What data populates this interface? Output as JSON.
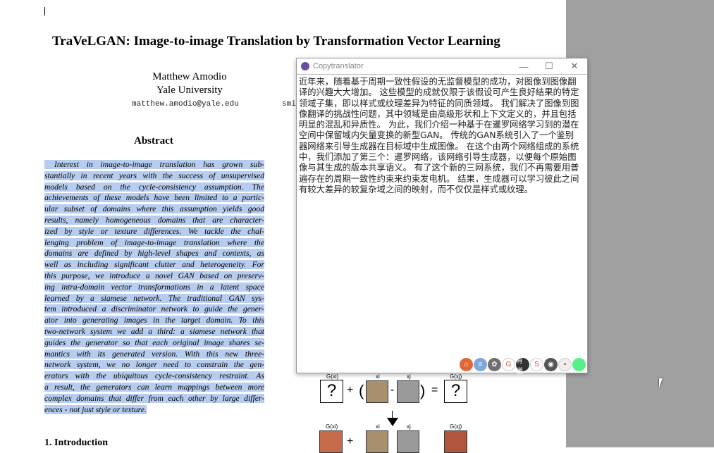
{
  "paper": {
    "title": "TraVeLGAN: Image-to-image Translation by Transformation Vector Learning",
    "author_name": "Matthew Amodio",
    "author_affil": "Yale University",
    "author_email": "matthew.amodio@yale.edu",
    "author2_email_partial": "smi",
    "abstract_heading": "Abstract",
    "abstract_lines": [
      "Interest in image-to-image translation has grown sub-",
      "stantially in recent years with the success of unsupervised",
      "models based on the cycle-consistency assumption.  The",
      "achievements of these models have been limited to a partic-",
      "ular subset of domains where this assumption yields good",
      "results, namely homogeneous domains that are character-",
      "ized by style or texture differences.  We tackle the chal-",
      "lenging problem of image-to-image translation where the",
      "domains are defined by high-level shapes and contexts, as",
      "well as including significant clutter and heterogeneity.  For",
      "this purpose, we introduce a novel GAN based on preserv-",
      "ing intra-domain vector transformations in a latent space",
      "learned by a siamese network.  The traditional GAN sys-",
      "tem introduced a discriminator network to guide the gener-",
      "ator into generating images in the target domain.  To this",
      "two-network system we add a third: a siamese network that",
      "guides the generator so that each original image shares se-",
      "mantics with its generated version.  With this new three-",
      "network system, we no longer need to constrain the gen-",
      "erators with the ubiquitous cycle-consistency restraint.  As",
      "a result, the generators can learn mappings between more",
      "complex domains that differ from each other by large differ-",
      "ences - not just style or texture."
    ],
    "intro_heading": "1. Introduction",
    "figure": {
      "gxi": "G(xi)",
      "gxj": "G(xj)",
      "xi": "xi",
      "xj": "xj",
      "q": "?",
      "plus": "+",
      "minus": "-",
      "eq": "=",
      "lp": "(",
      "rp": ")"
    }
  },
  "window": {
    "title": "Copytranslator",
    "minimize": "—",
    "maximize": "☐",
    "close": "✕",
    "translation_lines": [
      "近年来，随着基于周期一致性假设的无监督模型的成功，对图像到图像翻",
      "译的兴趣大大增加。 这些模型的成就仅限于该假设可产生良好结果的特定",
      "领域子集，即以样式或纹理差异为特征的同质领域。 我们解决了图像到图",
      "像翻译的挑战性问题，其中领域是由高级形状和上下文定义的，并且包括",
      "明显的混乱和异质性。 为此，我们介绍一种基于在暹罗网络学习到的潜在",
      "空间中保留域内矢量变换的新型GAN。 传统的GAN系统引入了一个鉴别",
      "器网络来引导生成器在目标域中生成图像。 在这个由两个网络组成的系统",
      "中，我们添加了第三个：暹罗网络，该网络引导生成器，以便每个原始图",
      "像与其生成的版本共享语义。 有了这个新的三网系统，我们不再需要用普",
      "遍存在的周期一致性约束来约束发电机。 结果，生成器可以学习彼此之间",
      "有较大差异的较复杂域之间的映射，而不仅仅是样式或纹理。"
    ],
    "engines": [
      {
        "name": "home",
        "color": "#e0663a",
        "glyph": "⌂"
      },
      {
        "name": "docs",
        "color": "#7fa7d9",
        "glyph": "≡"
      },
      {
        "name": "baidu",
        "color": "#6f6f6f",
        "glyph": "✿"
      },
      {
        "name": "google",
        "color": "#ffffff",
        "glyph": "G"
      },
      {
        "name": "youdao",
        "color": "#333333",
        "glyph": "有道"
      },
      {
        "name": "sogou",
        "color": "#ffffff",
        "glyph": "S"
      },
      {
        "name": "caiyun",
        "color": "#555555",
        "glyph": "◉"
      },
      {
        "name": "bing",
        "color": "#eeeeee",
        "glyph": "▪"
      },
      {
        "name": "status",
        "color": "#55f08a",
        "glyph": ""
      }
    ]
  }
}
